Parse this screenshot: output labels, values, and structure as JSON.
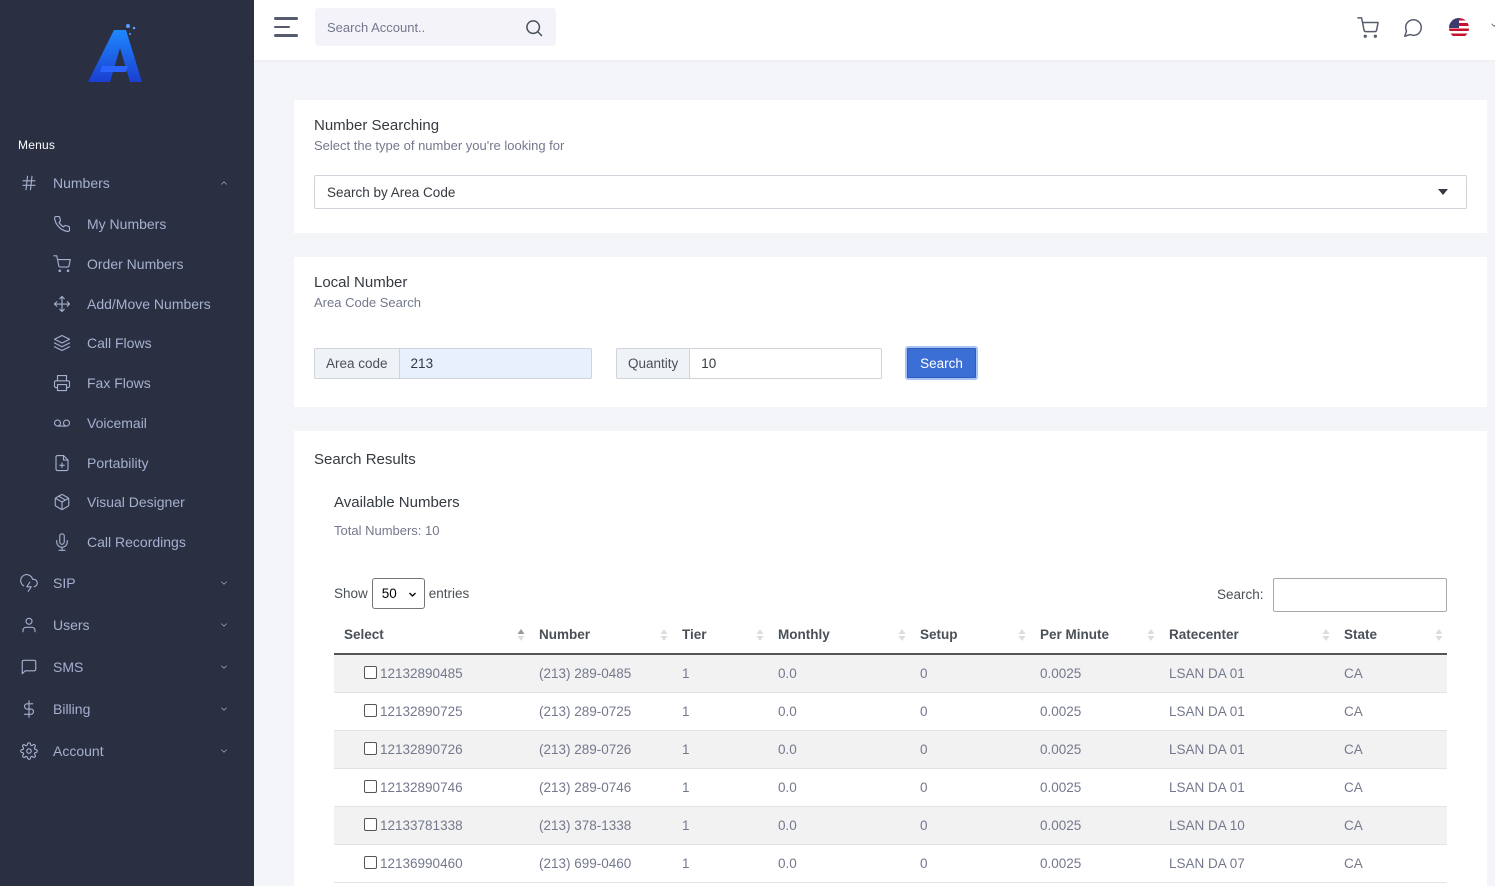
{
  "sidebar": {
    "menus_title": "Menus",
    "numbers": {
      "label": "Numbers",
      "items": [
        {
          "label": "My Numbers",
          "icon": "phone-icon"
        },
        {
          "label": "Order Numbers",
          "icon": "cart-icon"
        },
        {
          "label": "Add/Move Numbers",
          "icon": "move-icon"
        },
        {
          "label": "Call Flows",
          "icon": "layers-icon"
        },
        {
          "label": "Fax Flows",
          "icon": "printer-icon"
        },
        {
          "label": "Voicemail",
          "icon": "voicemail-icon"
        },
        {
          "label": "Portability",
          "icon": "file-plus-icon"
        },
        {
          "label": "Visual Designer",
          "icon": "package-icon"
        },
        {
          "label": "Call Recordings",
          "icon": "microphone-icon"
        }
      ]
    },
    "sections": [
      {
        "label": "SIP",
        "icon": "cloud-lightning-icon"
      },
      {
        "label": "Users",
        "icon": "user-icon"
      },
      {
        "label": "SMS",
        "icon": "message-square-icon"
      },
      {
        "label": "Billing",
        "icon": "dollar-icon"
      },
      {
        "label": "Account",
        "icon": "settings-icon"
      }
    ]
  },
  "header": {
    "search_placeholder": "Search Account.."
  },
  "number_searching": {
    "title": "Number Searching",
    "subtitle": "Select the type of number you're looking for",
    "select_value": "Search by Area Code"
  },
  "local_number": {
    "title": "Local Number",
    "subtitle": "Area Code Search",
    "area_code_label": "Area code",
    "area_code_value": "213",
    "quantity_label": "Quantity",
    "quantity_value": "10",
    "search_button": "Search"
  },
  "results": {
    "title": "Search Results",
    "available_title": "Available Numbers",
    "total": "Total Numbers: 10",
    "show_label": "Show",
    "entries_value": "50",
    "entries_label": "entries",
    "search_label": "Search:",
    "columns": [
      "Select",
      "Number",
      "Tier",
      "Monthly",
      "Setup",
      "Per Minute",
      "Ratecenter",
      "State"
    ],
    "rows": [
      {
        "select": "12132890485",
        "number": "(213) 289-0485",
        "tier": "1",
        "monthly": "0.0",
        "setup": "0",
        "per_minute": "0.0025",
        "ratecenter": "LSAN DA 01",
        "state": "CA"
      },
      {
        "select": "12132890725",
        "number": "(213) 289-0725",
        "tier": "1",
        "monthly": "0.0",
        "setup": "0",
        "per_minute": "0.0025",
        "ratecenter": "LSAN DA 01",
        "state": "CA"
      },
      {
        "select": "12132890726",
        "number": "(213) 289-0726",
        "tier": "1",
        "monthly": "0.0",
        "setup": "0",
        "per_minute": "0.0025",
        "ratecenter": "LSAN DA 01",
        "state": "CA"
      },
      {
        "select": "12132890746",
        "number": "(213) 289-0746",
        "tier": "1",
        "monthly": "0.0",
        "setup": "0",
        "per_minute": "0.0025",
        "ratecenter": "LSAN DA 01",
        "state": "CA"
      },
      {
        "select": "12133781338",
        "number": "(213) 378-1338",
        "tier": "1",
        "monthly": "0.0",
        "setup": "0",
        "per_minute": "0.0025",
        "ratecenter": "LSAN DA 10",
        "state": "CA"
      },
      {
        "select": "12136990460",
        "number": "(213) 699-0460",
        "tier": "1",
        "monthly": "0.0",
        "setup": "0",
        "per_minute": "0.0025",
        "ratecenter": "LSAN DA 07",
        "state": "CA"
      }
    ]
  }
}
